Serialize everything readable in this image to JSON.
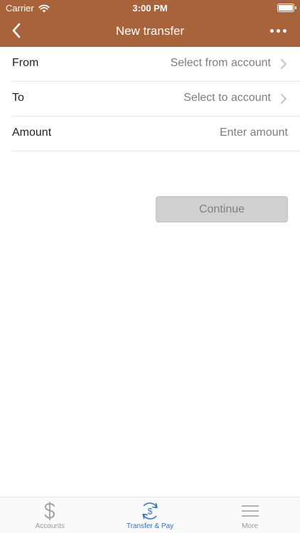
{
  "status_bar": {
    "carrier": "Carrier",
    "time": "3:00 PM"
  },
  "nav": {
    "title": "New transfer",
    "back_icon": "chevron-left-icon",
    "more_icon": "ellipsis-icon"
  },
  "form": {
    "from": {
      "label": "From",
      "value": "Select from account"
    },
    "to": {
      "label": "To",
      "value": "Select to account"
    },
    "amount": {
      "label": "Amount",
      "placeholder": "Enter amount"
    }
  },
  "continue_label": "Continue",
  "tabs": [
    {
      "label": "Accounts",
      "icon": "dollar-icon",
      "active": false
    },
    {
      "label": "Transfer & Pay",
      "icon": "transfer-dollar-icon",
      "active": true
    },
    {
      "label": "More",
      "icon": "menu-icon",
      "active": false
    }
  ],
  "colors": {
    "header": "#a8633a",
    "active_tab": "#2f73c4",
    "inactive_tab": "#9a9a9a"
  }
}
